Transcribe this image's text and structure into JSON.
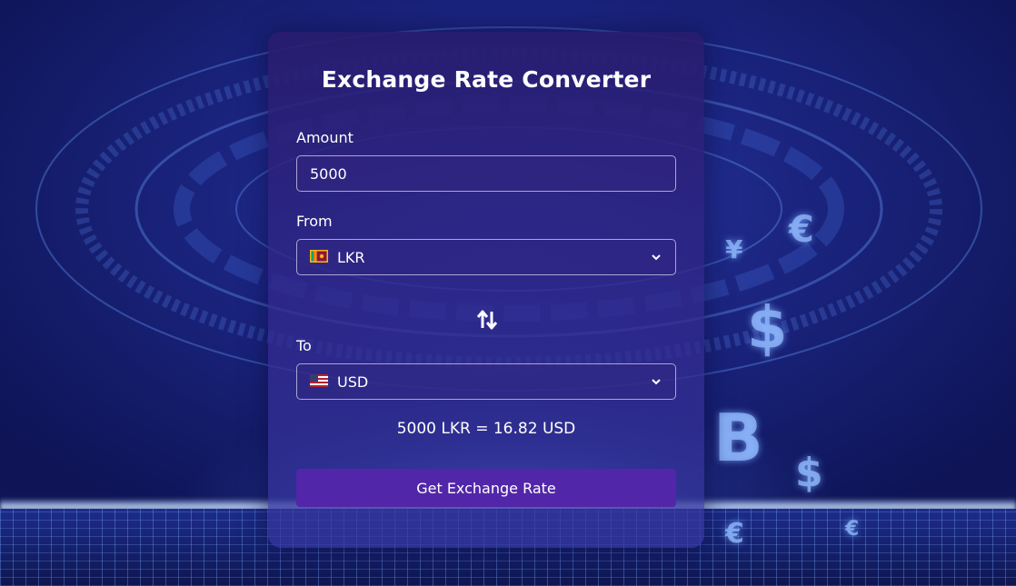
{
  "converter": {
    "title": "Exchange Rate Converter",
    "amount_label": "Amount",
    "amount_value": "5000",
    "from_label": "From",
    "from_currency": "LKR",
    "from_flag_icon": "sri-lanka-flag-icon",
    "to_label": "To",
    "to_currency": "USD",
    "to_flag_icon": "us-flag-icon",
    "swap_icon": "swap-arrows-icon",
    "result_text": "5000 LKR = 16.82 USD",
    "button_label": "Get Exchange Rate"
  },
  "colors": {
    "background": "#1b2580",
    "card": "#2c1f78",
    "button": "#5226a8",
    "text": "#ffffff"
  }
}
